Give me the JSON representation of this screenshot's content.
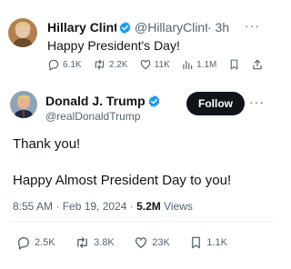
{
  "reply": {
    "name": "Hillary Clinto",
    "handle": "@HillaryClint",
    "time": "· 3h",
    "text": "Happy President's Day!",
    "more": "···",
    "replies": "6.1K",
    "reposts": "2.2K",
    "likes": "11K",
    "views": "1.1M"
  },
  "tweet": {
    "name": "Donald J. Trump",
    "handle": "@realDonaldTrump",
    "follow_label": "Follow",
    "more": "···",
    "line1": "Thank you!",
    "line2": "Happy Almost President Day to you!",
    "timestamp": "8:55 AM · Feb 19, 2024 · ",
    "views_count": "5.2M",
    "views_label": " Views",
    "replies": "2.5K",
    "reposts": "3.8K",
    "likes": "23K",
    "bookmarks": "1.1K"
  },
  "colors": {
    "verified": "#1d9bf0",
    "muted": "#536471",
    "text": "#0f1419"
  }
}
